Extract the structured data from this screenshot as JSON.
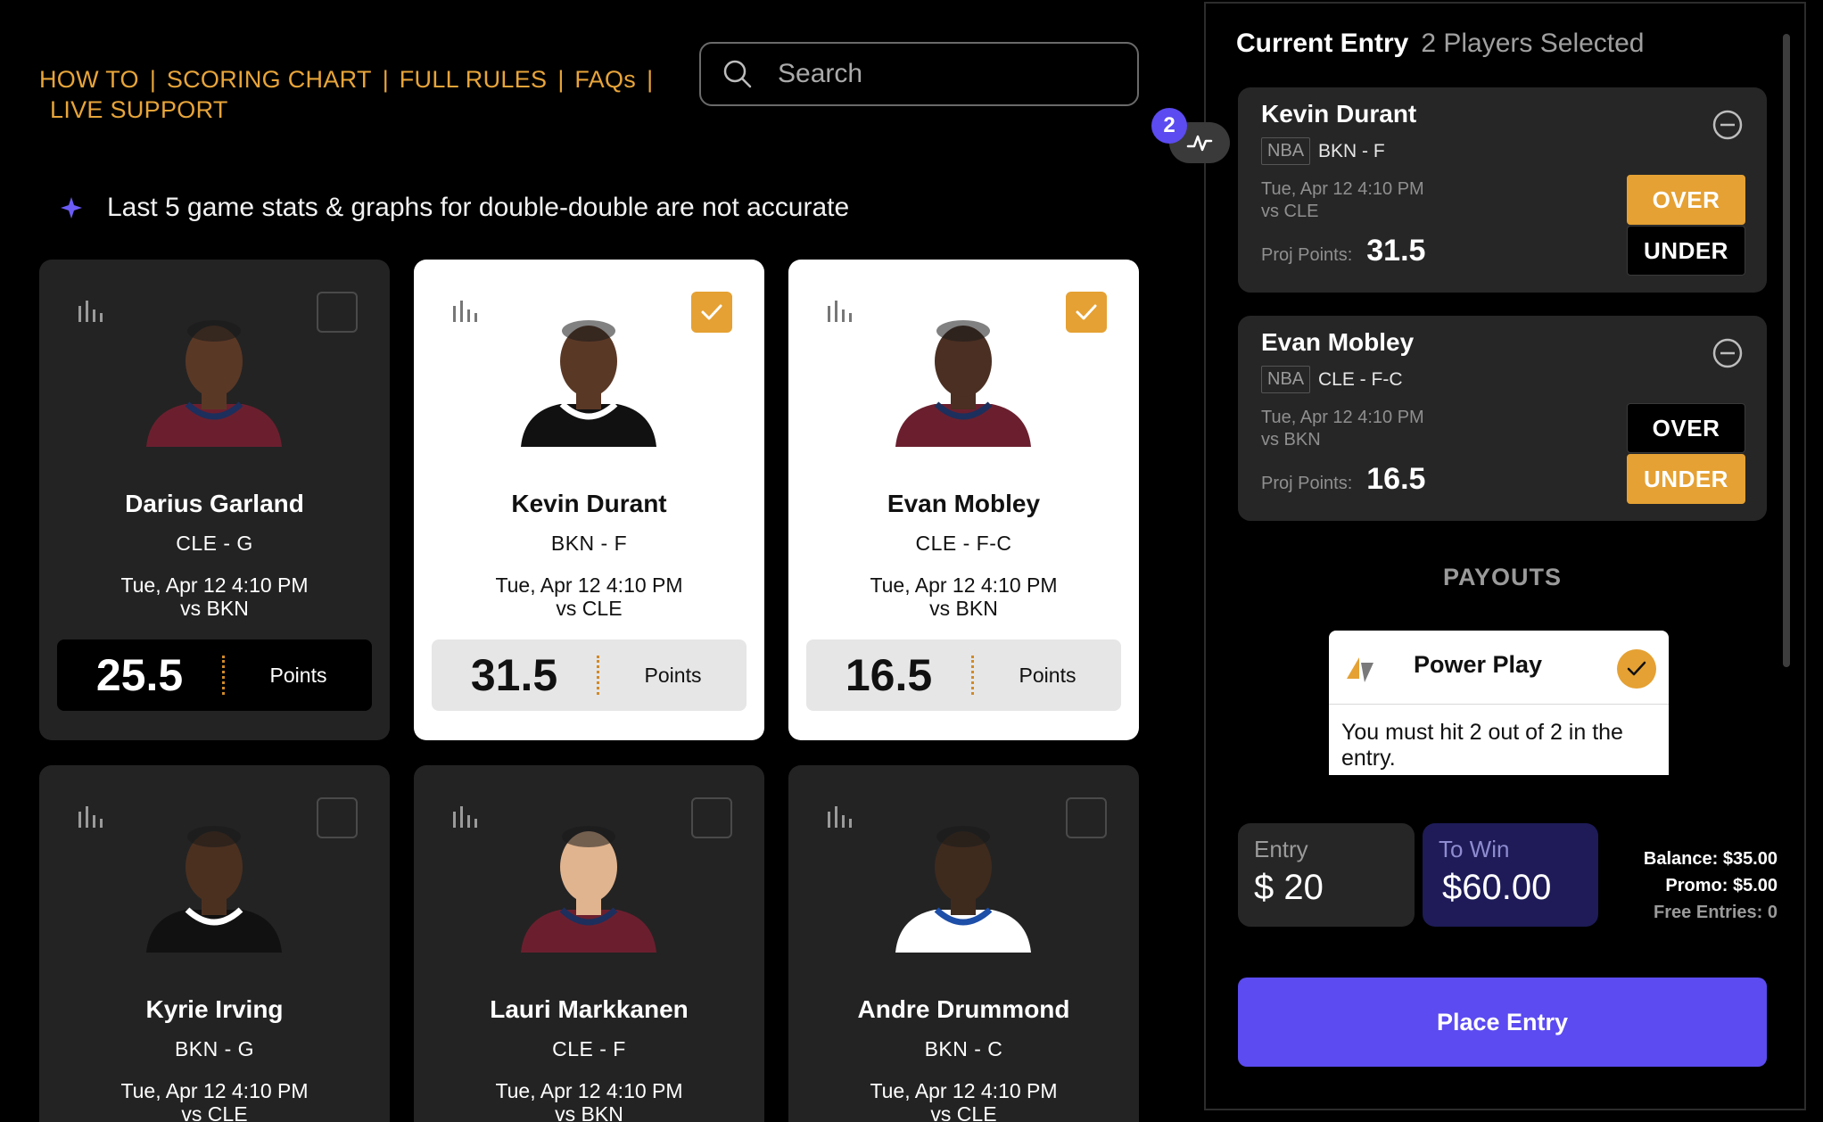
{
  "nav": {
    "links": [
      "HOW TO",
      "SCORING CHART",
      "FULL RULES",
      "FAQs",
      "LIVE SUPPORT"
    ],
    "separator": "|"
  },
  "search": {
    "placeholder": "Search"
  },
  "notice": {
    "text": "Last 5 game stats & graphs for double-double are not accurate"
  },
  "badge": {
    "count": "2"
  },
  "players": [
    {
      "name": "Darius Garland",
      "team_pos": "CLE - G",
      "game_time": "Tue, Apr 12 4:10 PM",
      "opponent": "vs BKN",
      "line": "25.5",
      "stat": "Points",
      "selected": false,
      "jersey": "#6B1F2E",
      "trim": "#1D2F5C"
    },
    {
      "name": "Kevin Durant",
      "team_pos": "BKN - F",
      "game_time": "Tue, Apr 12 4:10 PM",
      "opponent": "vs CLE",
      "line": "31.5",
      "stat": "Points",
      "selected": true,
      "jersey": "#111111",
      "trim": "#ffffff"
    },
    {
      "name": "Evan Mobley",
      "team_pos": "CLE - F-C",
      "game_time": "Tue, Apr 12 4:10 PM",
      "opponent": "vs BKN",
      "line": "16.5",
      "stat": "Points",
      "selected": true,
      "jersey": "#6B1F2E",
      "trim": "#1D2F5C"
    },
    {
      "name": "Kyrie Irving",
      "team_pos": "BKN - G",
      "game_time": "Tue, Apr 12 4:10 PM",
      "opponent": "vs CLE",
      "line": "",
      "stat": "",
      "selected": false,
      "jersey": "#111111",
      "trim": "#ffffff"
    },
    {
      "name": "Lauri Markkanen",
      "team_pos": "CLE - F",
      "game_time": "Tue, Apr 12 4:10 PM",
      "opponent": "vs BKN",
      "line": "",
      "stat": "",
      "selected": false,
      "jersey": "#6B1F2E",
      "trim": "#1D2F5C"
    },
    {
      "name": "Andre Drummond",
      "team_pos": "BKN - C",
      "game_time": "Tue, Apr 12 4:10 PM",
      "opponent": "vs CLE",
      "line": "",
      "stat": "",
      "selected": false,
      "jersey": "#ffffff",
      "trim": "#1D4EA8"
    }
  ],
  "entry": {
    "title": "Current Entry",
    "count_text": "2 Players Selected",
    "picks": [
      {
        "name": "Kevin Durant",
        "league": "NBA",
        "team_pos": "BKN - F",
        "game_time": "Tue, Apr 12 4:10 PM",
        "opponent": "vs CLE",
        "proj_label": "Proj Points:",
        "proj_value": "31.5",
        "over_label": "OVER",
        "under_label": "UNDER",
        "pick": "over"
      },
      {
        "name": "Evan Mobley",
        "league": "NBA",
        "team_pos": "CLE - F-C",
        "game_time": "Tue, Apr 12 4:10 PM",
        "opponent": "vs BKN",
        "proj_label": "Proj Points:",
        "proj_value": "16.5",
        "over_label": "OVER",
        "under_label": "UNDER",
        "pick": "under"
      }
    ],
    "payouts_title": "PAYOUTS",
    "power_play": {
      "title": "Power Play",
      "description": "You must hit 2 out of 2 in the entry."
    },
    "entry_label": "Entry",
    "entry_value": "$ 20",
    "to_win_label": "To Win",
    "to_win_value": "$60.00",
    "balance": "Balance: $35.00",
    "promo": "Promo: $5.00",
    "free_entries": "Free Entries: 0",
    "place_button": "Place Entry"
  },
  "colors": {
    "accent_gold": "#E5A133",
    "nav_gold": "#E8A53A",
    "primary_purple": "#5B4BF0",
    "to_win_bg": "#1E1B58",
    "card_dark": "#232323",
    "card_selected": "#ffffff"
  },
  "icons": [
    "search-icon",
    "star-icon",
    "stats-icon",
    "check-icon",
    "activity-icon",
    "remove-circle-icon",
    "power-play-logo-icon"
  ]
}
